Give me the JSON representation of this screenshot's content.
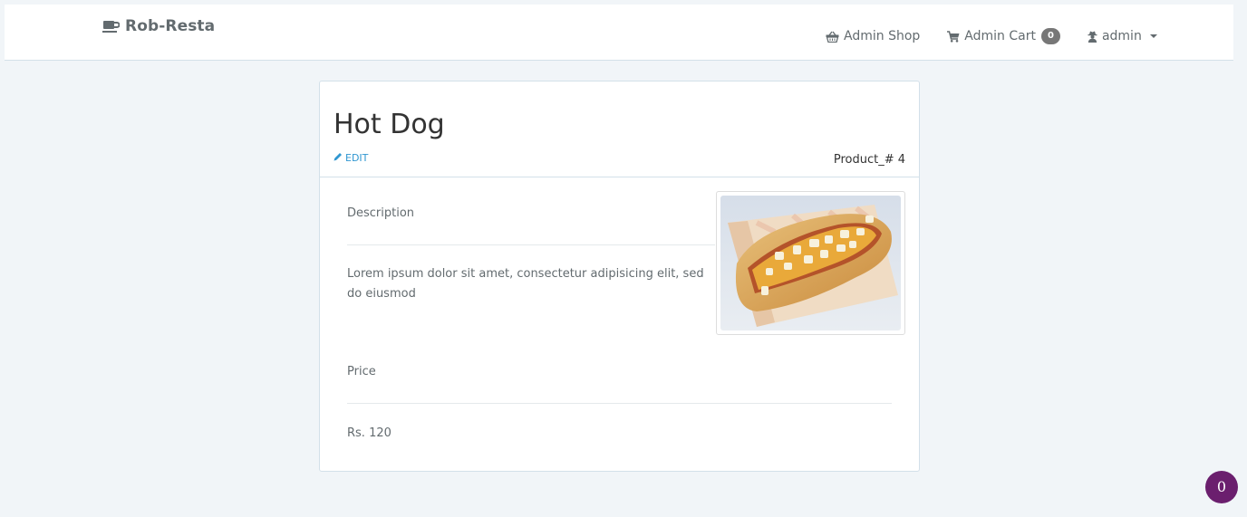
{
  "navbar": {
    "brand": "Rob-Resta",
    "brand_icon": "coffee-icon",
    "links": {
      "shop": {
        "label": "Admin Shop",
        "icon": "basket-icon"
      },
      "cart": {
        "label": "Admin Cart",
        "icon": "cart-icon",
        "count": "0"
      },
      "user": {
        "label": "admin",
        "icon": "user-secret-icon"
      }
    }
  },
  "product": {
    "title": "Hot Dog",
    "edit_label": "Edit",
    "number_label": "Product_# 4",
    "description_label": "Description",
    "description": "Lorem ipsum dolor sit amet, consectetur adipisicing elit, sed do eiusmod",
    "price_label": "Price",
    "price": "Rs. 120",
    "image": "hot-dog-photo"
  },
  "floating_badge": {
    "value": "0"
  },
  "colors": {
    "background": "#f1f5f8",
    "link": "#3097d1",
    "badge": "#777777",
    "floating_badge": "#6b1f6e"
  }
}
